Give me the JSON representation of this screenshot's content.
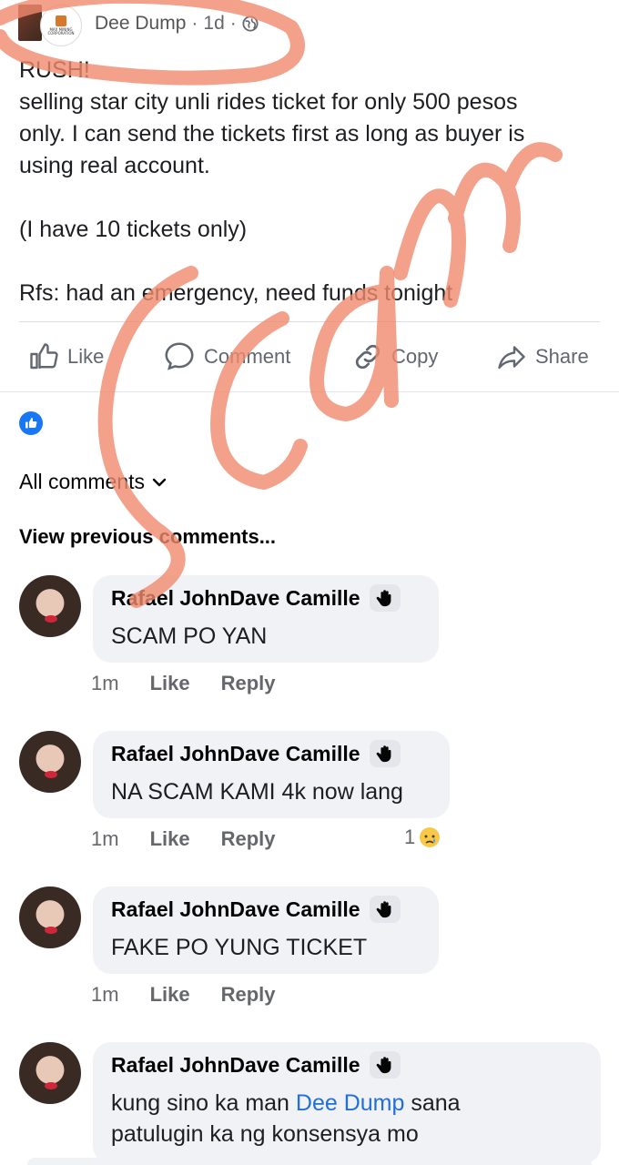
{
  "post": {
    "author": "Dee Dump",
    "time": "1d",
    "privacy_icon": "globe-icon",
    "logo_text": "MAX MINING CORPORATION",
    "lines": [
      "RUSH!",
      "selling star city unli rides ticket for only 500 pesos",
      "only. I can send the tickets first as long as buyer is",
      "using real account.",
      "",
      "(I have 10 tickets only)",
      "",
      "Rfs: had an emergency, need funds tonight"
    ]
  },
  "actions": {
    "like": "Like",
    "comment": "Comment",
    "copy": "Copy",
    "share": "Share"
  },
  "reactions": {
    "icon": "like-reaction-icon"
  },
  "comments_filter": "All comments",
  "view_previous": "View previous comments...",
  "comments": [
    {
      "name": "Rafael JohnDave Camille",
      "badge_icon": "wave-hand-icon",
      "text": "SCAM PO YAN",
      "time": "1m",
      "like": "Like",
      "reply": "Reply"
    },
    {
      "name": "Rafael JohnDave Camille",
      "badge_icon": "wave-hand-icon",
      "text": "NA SCAM KAMI 4k now lang",
      "time": "1m",
      "like": "Like",
      "reply": "Reply",
      "reaction_count": "1",
      "reaction_icon": "sad-face-icon"
    },
    {
      "name": "Rafael JohnDave Camille",
      "badge_icon": "wave-hand-icon",
      "text": "FAKE PO YUNG TICKET",
      "time": "1m",
      "like": "Like",
      "reply": "Reply"
    },
    {
      "name": "Rafael JohnDave Camille",
      "badge_icon": "wave-hand-icon",
      "text_prefix": "kung sino ka man ",
      "mention": "Dee Dump",
      "text_suffix": " sana",
      "text_line2": "patulugin ka ng konsensya mo"
    }
  ],
  "overlay": {
    "word": "scam",
    "color": "#f08a6e"
  },
  "colors": {
    "link": "#216fdb",
    "like_blue": "#1877f2",
    "bubble": "#f0f2f5"
  }
}
